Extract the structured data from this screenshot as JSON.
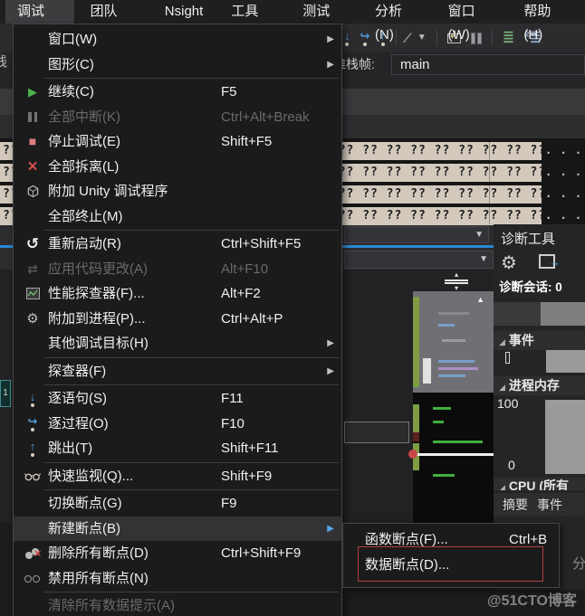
{
  "menubar": {
    "items": [
      {
        "name": "debug",
        "label": "调试(D)",
        "active": true
      },
      {
        "name": "team",
        "label": "团队(M)"
      },
      {
        "name": "nsight",
        "label": "Nsight"
      },
      {
        "name": "tools",
        "label": "工具(T)"
      },
      {
        "name": "test",
        "label": "测试(S)"
      },
      {
        "name": "analyze",
        "label": "分析(N)"
      },
      {
        "name": "window",
        "label": "窗口(W)"
      },
      {
        "name": "help",
        "label": "帮助(H)"
      }
    ]
  },
  "toolbar": {
    "icons": [
      {
        "name": "step-into-icon"
      },
      {
        "name": "step-over-icon"
      },
      {
        "name": "step-out-icon"
      },
      {
        "name": "divider"
      },
      {
        "name": "breakpoints-icon"
      },
      {
        "name": "dropdown-caret-icon"
      },
      {
        "name": "divider"
      },
      {
        "name": "show-next-statement-icon"
      },
      {
        "name": "parallel-stacks-icon"
      },
      {
        "name": "divider"
      },
      {
        "name": "output-window-icon"
      },
      {
        "name": "process-list-icon"
      }
    ]
  },
  "stack_frame": {
    "label": "堆栈帧:",
    "value": "main"
  },
  "memory": {
    "row_text": "?? ?? ?? ?? ?? ?? ?? ?? ?? ?? ?? ?? ?? ?? ?? ?? ?? ?? ?? ?? ?? ?? ?? ?? ?? ??",
    "dots": ". . . . .",
    "rows": 4
  },
  "debug_menu": {
    "items": [
      {
        "type": "item",
        "name": "window",
        "label": "窗口(W)",
        "arrow": true
      },
      {
        "type": "item",
        "name": "graphics",
        "label": "图形(C)",
        "arrow": true
      },
      {
        "type": "sep"
      },
      {
        "type": "item",
        "name": "continue",
        "label": "继续(C)",
        "shortcut": "F5",
        "icon": "continue-icon"
      },
      {
        "type": "item",
        "name": "break-all",
        "label": "全部中断(K)",
        "shortcut": "Ctrl+Alt+Break",
        "icon": "break-all-icon",
        "disabled": true
      },
      {
        "type": "item",
        "name": "stop-debugging",
        "label": "停止调试(E)",
        "shortcut": "Shift+F5",
        "icon": "stop-icon"
      },
      {
        "type": "item",
        "name": "detach-all",
        "label": "全部拆离(L)",
        "icon": "detach-icon"
      },
      {
        "type": "item",
        "name": "attach-unity",
        "label": "附加 Unity 调试程序",
        "icon": "unity-icon"
      },
      {
        "type": "item",
        "name": "terminate-all",
        "label": "全部终止(M)"
      },
      {
        "type": "sep"
      },
      {
        "type": "item",
        "name": "restart",
        "label": "重新启动(R)",
        "shortcut": "Ctrl+Shift+F5",
        "icon": "restart-icon"
      },
      {
        "type": "item",
        "name": "apply-code-changes",
        "label": "应用代码更改(A)",
        "shortcut": "Alt+F10",
        "icon": "apply-changes-icon",
        "disabled": true
      },
      {
        "type": "item",
        "name": "performance-profiler",
        "label": "性能探查器(F)...",
        "shortcut": "Alt+F2",
        "icon": "profiler-icon"
      },
      {
        "type": "item",
        "name": "attach-to-process",
        "label": "附加到进程(P)...",
        "shortcut": "Ctrl+Alt+P",
        "icon": "attach-process-icon"
      },
      {
        "type": "item",
        "name": "other-debug-targets",
        "label": "其他调试目标(H)",
        "arrow": true
      },
      {
        "type": "sep"
      },
      {
        "type": "item",
        "name": "profiler",
        "label": "探查器(F)",
        "arrow": true
      },
      {
        "type": "sep"
      },
      {
        "type": "item",
        "name": "step-into",
        "label": "逐语句(S)",
        "shortcut": "F11",
        "icon": "step-into-icon"
      },
      {
        "type": "item",
        "name": "step-over",
        "label": "逐过程(O)",
        "shortcut": "F10",
        "icon": "step-over-icon"
      },
      {
        "type": "item",
        "name": "step-out",
        "label": "跳出(T)",
        "shortcut": "Shift+F11",
        "icon": "step-out-icon"
      },
      {
        "type": "sep"
      },
      {
        "type": "item",
        "name": "quick-watch",
        "label": "快速监视(Q)...",
        "shortcut": "Shift+F9",
        "icon": "quick-watch-icon"
      },
      {
        "type": "sep"
      },
      {
        "type": "item",
        "name": "toggle-breakpoint",
        "label": "切换断点(G)",
        "shortcut": "F9"
      },
      {
        "type": "item",
        "name": "new-breakpoint",
        "label": "新建断点(B)",
        "arrow": true,
        "highlighted": true
      },
      {
        "type": "item",
        "name": "delete-all-breakpoints",
        "label": "删除所有断点(D)",
        "shortcut": "Ctrl+Shift+F9",
        "icon": "delete-breakpoints-icon"
      },
      {
        "type": "item",
        "name": "disable-all-breakpoints",
        "label": "禁用所有断点(N)",
        "icon": "disable-breakpoints-icon"
      },
      {
        "type": "sep"
      },
      {
        "type": "item",
        "name": "clear-all-datatips",
        "label": "清除所有数据提示(A)",
        "disabled": true
      }
    ]
  },
  "breakpoint_submenu": {
    "items": [
      {
        "name": "function-breakpoint",
        "label": "函数断点(F)...",
        "shortcut": "Ctrl+B"
      },
      {
        "name": "data-breakpoint",
        "label": "数据断点(D)...",
        "annotated": true
      }
    ]
  },
  "diagnostics": {
    "title": "诊断工具",
    "session": "诊断会话: 0",
    "events_label": "事件",
    "memory_label": "进程内存",
    "mem_max": "100",
    "mem_min": "0",
    "cpu_label": "CPU (所有",
    "tabs": [
      "摘要",
      "事件"
    ]
  },
  "fragments": {
    "left_text": "线",
    "right_text": "分",
    "gutter_text": "1"
  },
  "watermark": "@51CTO博客",
  "colors": {
    "accent_blue": "#2a8ad4",
    "annotation_red": "#b23f3f",
    "memory_beige": "#d2c9bc",
    "menu_bg": "#1b1b1c",
    "menu_highlight": "#333336",
    "step_icon_blue": "#4e9cd8",
    "continue_green": "#4db04d",
    "stop_salmon": "#df7e7e",
    "detach_red": "#d04c4c"
  }
}
